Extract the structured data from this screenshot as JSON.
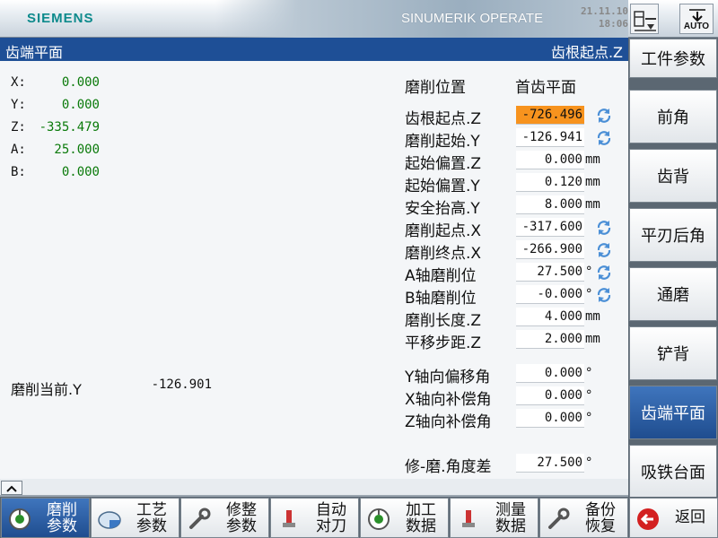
{
  "header": {
    "brand": "SIEMENS",
    "product": "SINUMERIK OPERATE",
    "date": "21.11.10",
    "time": "18:06",
    "mode_label": "AUTO"
  },
  "title": {
    "left": "齿端平面",
    "right": "齿根起点.Z"
  },
  "axes": [
    {
      "name": "X:",
      "value": "0.000"
    },
    {
      "name": "Y:",
      "value": "0.000"
    },
    {
      "name": "Z:",
      "value": "-335.479"
    },
    {
      "name": "A:",
      "value": "25.000"
    },
    {
      "name": "B:",
      "value": "0.000"
    }
  ],
  "position": {
    "label": "磨削位置",
    "value": "首齿平面"
  },
  "params": [
    {
      "label": "齿根起点.Z",
      "value": "-726.496",
      "unit": "",
      "sync": true
    },
    {
      "label": "磨削起始.Y",
      "value": "-126.941",
      "unit": "",
      "sync": true
    },
    {
      "label": "起始偏置.Z",
      "value": "0.000",
      "unit": "mm",
      "sync": false
    },
    {
      "label": "起始偏置.Y",
      "value": "0.120",
      "unit": "mm",
      "sync": false
    },
    {
      "label": "安全抬高.Y",
      "value": "8.000",
      "unit": "mm",
      "sync": false
    },
    {
      "label": "磨削起点.X",
      "value": "-317.600",
      "unit": "",
      "sync": true
    },
    {
      "label": "磨削终点.X",
      "value": "-266.900",
      "unit": "",
      "sync": true
    },
    {
      "label": "A轴磨削位",
      "value": "27.500",
      "unit": "°",
      "sync": true
    },
    {
      "label": "B轴磨削位",
      "value": "-0.000",
      "unit": "°",
      "sync": true
    },
    {
      "label": "磨削长度.Z",
      "value": "4.000",
      "unit": "mm",
      "sync": false
    },
    {
      "label": "平移步距.Z",
      "value": "2.000",
      "unit": "mm",
      "sync": false
    }
  ],
  "offsets": [
    {
      "label": "Y轴向偏移角",
      "value": "0.000",
      "unit": "°"
    },
    {
      "label": "X轴向补偿角",
      "value": "0.000",
      "unit": "°"
    },
    {
      "label": "Z轴向补偿角",
      "value": "0.000",
      "unit": "°"
    }
  ],
  "current": {
    "label": "磨削当前.Y",
    "value": "-126.901"
  },
  "angle_diff": {
    "label": "修-磨.角度差",
    "value": "27.500",
    "unit": "°"
  },
  "right_keys": [
    "工件参数",
    "前角",
    "齿背",
    "平刃后角",
    "通磨",
    "铲背",
    "齿端平面",
    "吸铁台面"
  ],
  "bottom_keys": [
    {
      "line1": "磨削",
      "line2": "参数",
      "icon": "grind-icon"
    },
    {
      "line1": "工艺",
      "line2": "参数",
      "icon": "disc-icon"
    },
    {
      "line1": "修整",
      "line2": "参数",
      "icon": "wrench-icon"
    },
    {
      "line1": "自动",
      "line2": "对刀",
      "icon": "probe-icon"
    },
    {
      "line1": "加工",
      "line2": "数据",
      "icon": "grind-icon"
    },
    {
      "line1": "测量",
      "line2": "数据",
      "icon": "probe-icon"
    },
    {
      "line1": "备份",
      "line2": "恢复",
      "icon": "wrench-icon"
    },
    {
      "line1": "返回",
      "line2": "",
      "icon": "back-arrow-icon"
    }
  ],
  "colors": {
    "title_blue": "#1e4f96",
    "active_field": "#f7931e",
    "axis_green": "#0a7a0a",
    "brand_teal": "#0d8a8c"
  }
}
